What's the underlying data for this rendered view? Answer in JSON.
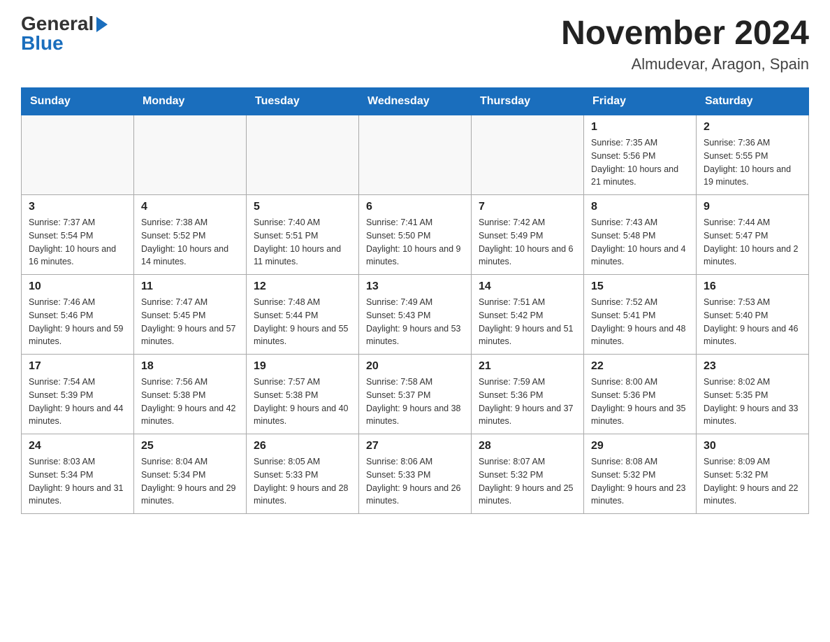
{
  "header": {
    "logo_general": "General",
    "logo_blue": "Blue",
    "month": "November 2024",
    "location": "Almudevar, Aragon, Spain"
  },
  "weekdays": [
    "Sunday",
    "Monday",
    "Tuesday",
    "Wednesday",
    "Thursday",
    "Friday",
    "Saturday"
  ],
  "weeks": [
    [
      {
        "day": "",
        "sunrise": "",
        "sunset": "",
        "daylight": ""
      },
      {
        "day": "",
        "sunrise": "",
        "sunset": "",
        "daylight": ""
      },
      {
        "day": "",
        "sunrise": "",
        "sunset": "",
        "daylight": ""
      },
      {
        "day": "",
        "sunrise": "",
        "sunset": "",
        "daylight": ""
      },
      {
        "day": "",
        "sunrise": "",
        "sunset": "",
        "daylight": ""
      },
      {
        "day": "1",
        "sunrise": "Sunrise: 7:35 AM",
        "sunset": "Sunset: 5:56 PM",
        "daylight": "Daylight: 10 hours and 21 minutes."
      },
      {
        "day": "2",
        "sunrise": "Sunrise: 7:36 AM",
        "sunset": "Sunset: 5:55 PM",
        "daylight": "Daylight: 10 hours and 19 minutes."
      }
    ],
    [
      {
        "day": "3",
        "sunrise": "Sunrise: 7:37 AM",
        "sunset": "Sunset: 5:54 PM",
        "daylight": "Daylight: 10 hours and 16 minutes."
      },
      {
        "day": "4",
        "sunrise": "Sunrise: 7:38 AM",
        "sunset": "Sunset: 5:52 PM",
        "daylight": "Daylight: 10 hours and 14 minutes."
      },
      {
        "day": "5",
        "sunrise": "Sunrise: 7:40 AM",
        "sunset": "Sunset: 5:51 PM",
        "daylight": "Daylight: 10 hours and 11 minutes."
      },
      {
        "day": "6",
        "sunrise": "Sunrise: 7:41 AM",
        "sunset": "Sunset: 5:50 PM",
        "daylight": "Daylight: 10 hours and 9 minutes."
      },
      {
        "day": "7",
        "sunrise": "Sunrise: 7:42 AM",
        "sunset": "Sunset: 5:49 PM",
        "daylight": "Daylight: 10 hours and 6 minutes."
      },
      {
        "day": "8",
        "sunrise": "Sunrise: 7:43 AM",
        "sunset": "Sunset: 5:48 PM",
        "daylight": "Daylight: 10 hours and 4 minutes."
      },
      {
        "day": "9",
        "sunrise": "Sunrise: 7:44 AM",
        "sunset": "Sunset: 5:47 PM",
        "daylight": "Daylight: 10 hours and 2 minutes."
      }
    ],
    [
      {
        "day": "10",
        "sunrise": "Sunrise: 7:46 AM",
        "sunset": "Sunset: 5:46 PM",
        "daylight": "Daylight: 9 hours and 59 minutes."
      },
      {
        "day": "11",
        "sunrise": "Sunrise: 7:47 AM",
        "sunset": "Sunset: 5:45 PM",
        "daylight": "Daylight: 9 hours and 57 minutes."
      },
      {
        "day": "12",
        "sunrise": "Sunrise: 7:48 AM",
        "sunset": "Sunset: 5:44 PM",
        "daylight": "Daylight: 9 hours and 55 minutes."
      },
      {
        "day": "13",
        "sunrise": "Sunrise: 7:49 AM",
        "sunset": "Sunset: 5:43 PM",
        "daylight": "Daylight: 9 hours and 53 minutes."
      },
      {
        "day": "14",
        "sunrise": "Sunrise: 7:51 AM",
        "sunset": "Sunset: 5:42 PM",
        "daylight": "Daylight: 9 hours and 51 minutes."
      },
      {
        "day": "15",
        "sunrise": "Sunrise: 7:52 AM",
        "sunset": "Sunset: 5:41 PM",
        "daylight": "Daylight: 9 hours and 48 minutes."
      },
      {
        "day": "16",
        "sunrise": "Sunrise: 7:53 AM",
        "sunset": "Sunset: 5:40 PM",
        "daylight": "Daylight: 9 hours and 46 minutes."
      }
    ],
    [
      {
        "day": "17",
        "sunrise": "Sunrise: 7:54 AM",
        "sunset": "Sunset: 5:39 PM",
        "daylight": "Daylight: 9 hours and 44 minutes."
      },
      {
        "day": "18",
        "sunrise": "Sunrise: 7:56 AM",
        "sunset": "Sunset: 5:38 PM",
        "daylight": "Daylight: 9 hours and 42 minutes."
      },
      {
        "day": "19",
        "sunrise": "Sunrise: 7:57 AM",
        "sunset": "Sunset: 5:38 PM",
        "daylight": "Daylight: 9 hours and 40 minutes."
      },
      {
        "day": "20",
        "sunrise": "Sunrise: 7:58 AM",
        "sunset": "Sunset: 5:37 PM",
        "daylight": "Daylight: 9 hours and 38 minutes."
      },
      {
        "day": "21",
        "sunrise": "Sunrise: 7:59 AM",
        "sunset": "Sunset: 5:36 PM",
        "daylight": "Daylight: 9 hours and 37 minutes."
      },
      {
        "day": "22",
        "sunrise": "Sunrise: 8:00 AM",
        "sunset": "Sunset: 5:36 PM",
        "daylight": "Daylight: 9 hours and 35 minutes."
      },
      {
        "day": "23",
        "sunrise": "Sunrise: 8:02 AM",
        "sunset": "Sunset: 5:35 PM",
        "daylight": "Daylight: 9 hours and 33 minutes."
      }
    ],
    [
      {
        "day": "24",
        "sunrise": "Sunrise: 8:03 AM",
        "sunset": "Sunset: 5:34 PM",
        "daylight": "Daylight: 9 hours and 31 minutes."
      },
      {
        "day": "25",
        "sunrise": "Sunrise: 8:04 AM",
        "sunset": "Sunset: 5:34 PM",
        "daylight": "Daylight: 9 hours and 29 minutes."
      },
      {
        "day": "26",
        "sunrise": "Sunrise: 8:05 AM",
        "sunset": "Sunset: 5:33 PM",
        "daylight": "Daylight: 9 hours and 28 minutes."
      },
      {
        "day": "27",
        "sunrise": "Sunrise: 8:06 AM",
        "sunset": "Sunset: 5:33 PM",
        "daylight": "Daylight: 9 hours and 26 minutes."
      },
      {
        "day": "28",
        "sunrise": "Sunrise: 8:07 AM",
        "sunset": "Sunset: 5:32 PM",
        "daylight": "Daylight: 9 hours and 25 minutes."
      },
      {
        "day": "29",
        "sunrise": "Sunrise: 8:08 AM",
        "sunset": "Sunset: 5:32 PM",
        "daylight": "Daylight: 9 hours and 23 minutes."
      },
      {
        "day": "30",
        "sunrise": "Sunrise: 8:09 AM",
        "sunset": "Sunset: 5:32 PM",
        "daylight": "Daylight: 9 hours and 22 minutes."
      }
    ]
  ]
}
